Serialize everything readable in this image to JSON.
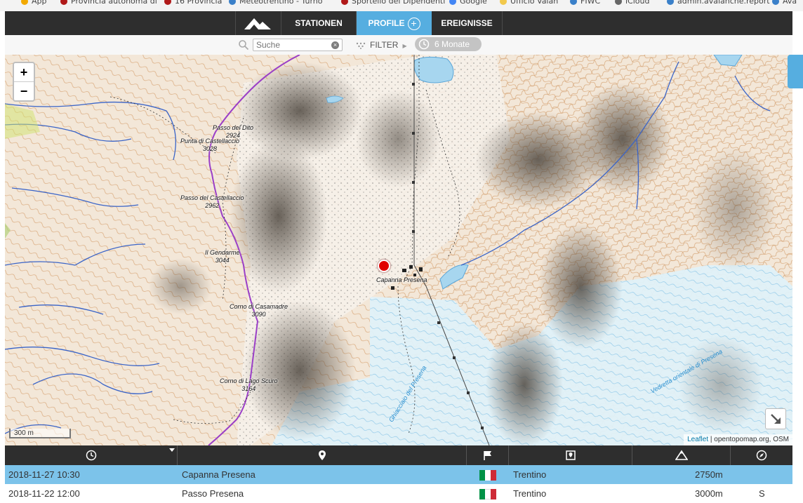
{
  "bookmarks": [
    {
      "label": "App",
      "color": "#f2a900"
    },
    {
      "label": "Provincia autonoma di",
      "color": "#b01919"
    },
    {
      "label": "16 Provincia",
      "color": "#b01919"
    },
    {
      "label": "Meteotrentino - Turno",
      "color": "#3a80c9"
    },
    {
      "label": "Sportello dei Dipendenti",
      "color": "#b01919"
    },
    {
      "label": "Google",
      "color": "#4285f4"
    },
    {
      "label": "Ufficio Valan",
      "color": "#f2c94c"
    },
    {
      "label": "FIWC",
      "color": "#3a80c9"
    },
    {
      "label": "iCloud",
      "color": "#666666"
    },
    {
      "label": "admin.avalanche.report",
      "color": "#3a80c9"
    },
    {
      "label": "Ava",
      "color": "#3a80c9"
    }
  ],
  "nav": {
    "logo_icon": "mountain-logo-icon",
    "tabs": [
      {
        "label": "STATIONEN",
        "active": false
      },
      {
        "label": "PROFILE",
        "active": true,
        "extra_icon": "plus-circle-icon"
      },
      {
        "label": "EREIGNISSE",
        "active": false
      }
    ],
    "active_color": "#56aee0",
    "bar_color": "#2e2e2e"
  },
  "filter": {
    "search_placeholder": "Suche",
    "search_icon": "search-icon",
    "clear_icon": "clear-icon",
    "filter_label": "FILTER",
    "period_label": "6 Monate",
    "period_icon": "clock-icon"
  },
  "map": {
    "zoom_in": "+",
    "zoom_out": "−",
    "scale": "300 m",
    "attribution_link": "Leaflet",
    "attribution_text": " | opentopomap.org, OSM",
    "marker_color": "#e00000",
    "labels": [
      {
        "name": "Passo del Dito",
        "elev": "2924"
      },
      {
        "name": "Punta di Castellaccio",
        "elev": "3028"
      },
      {
        "name": "Passo del Castellaccio",
        "elev": "2962"
      },
      {
        "name": "Il Gendarme",
        "elev": "3044"
      },
      {
        "name": "Corno di Casamadre",
        "elev": "3090"
      },
      {
        "name": "Corno di Lago Scuro",
        "elev": "3164"
      },
      {
        "name": "Capanna Presena",
        "elev": ""
      }
    ],
    "glacier_labels": [
      "Ghiacciaio del Presena",
      "Vedretta orientale di Presena"
    ]
  },
  "table": {
    "columns": [
      {
        "key": "time",
        "icon": "clock-icon"
      },
      {
        "key": "location",
        "icon": "map-pin-icon"
      },
      {
        "key": "country",
        "icon": "flag-icon"
      },
      {
        "key": "region",
        "icon": "region-pin-icon"
      },
      {
        "key": "altitude",
        "icon": "mountain-icon"
      },
      {
        "key": "aspect",
        "icon": "compass-icon"
      }
    ],
    "rows": [
      {
        "time": "2018-11-27 10:30",
        "location": "Capanna Presena",
        "flag": "Italy",
        "region": "Trentino",
        "altitude": "2750m",
        "aspect": ""
      },
      {
        "time": "2018-11-22 12:00",
        "location": "Passo Presena",
        "flag": "Italy",
        "region": "Trentino",
        "altitude": "3000m",
        "aspect": "S"
      }
    ],
    "selected_color": "#7cc3ea"
  }
}
